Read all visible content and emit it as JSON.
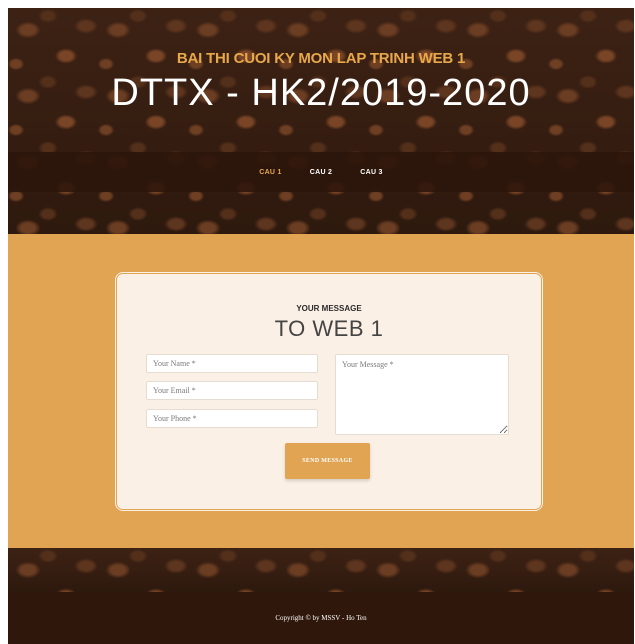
{
  "hero": {
    "subtitle": "BAI THI CUOI KY MON LAP TRINH WEB 1",
    "title": "DTTX - HK2/2019-2020"
  },
  "nav": {
    "items": [
      {
        "label": "CAU 1",
        "active": true
      },
      {
        "label": "CAU 2",
        "active": false
      },
      {
        "label": "CAU 3",
        "active": false
      }
    ]
  },
  "contact": {
    "subtitle": "YOUR MESSAGE",
    "title": "TO WEB 1",
    "name_placeholder": "Your Name *",
    "email_placeholder": "Your Email *",
    "phone_placeholder": "Your Phone *",
    "message_placeholder": "Your Message *",
    "send_label": "SEND MESSAGE"
  },
  "footer": {
    "copyright": "Copyright © by MSSV - Ho Ten"
  },
  "colors": {
    "accent": "#e0a453",
    "dark": "#2f170b",
    "card": "#fbf0e6"
  }
}
